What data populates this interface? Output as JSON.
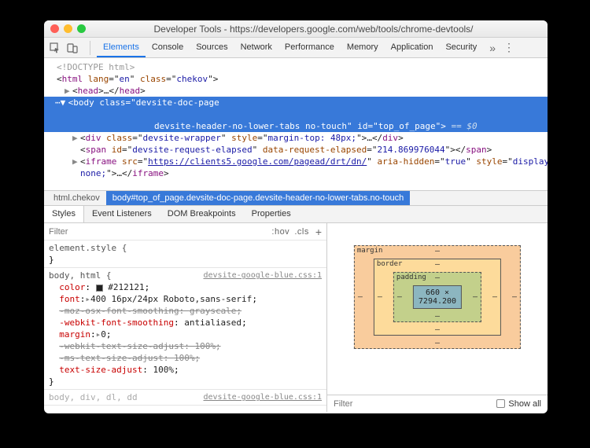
{
  "window": {
    "title": "Developer Tools - https://developers.google.com/web/tools/chrome-devtools/"
  },
  "toolbar": {
    "tabs": [
      "Elements",
      "Console",
      "Sources",
      "Network",
      "Performance",
      "Memory",
      "Application",
      "Security"
    ],
    "active": 0
  },
  "dom": {
    "doctype": "<!DOCTYPE html>",
    "html_open": {
      "tag": "html",
      "attrs": [
        [
          "lang",
          "en"
        ],
        [
          "class",
          "chekov"
        ]
      ]
    },
    "head": {
      "tag": "head",
      "ellipsis": "…"
    },
    "body_sel": {
      "tag": "body",
      "class_val": "devsite-doc-page",
      "class_tail": "devsite-header-no-lower-tabs no-touch",
      "id": "top_of_page",
      "eq0": "== $0"
    },
    "wrapper": {
      "tag": "div",
      "attrs": [
        [
          "class",
          "devsite-wrapper"
        ],
        [
          "style",
          "margin-top: 48px;"
        ]
      ],
      "ellipsis": "…"
    },
    "span": {
      "tag": "span",
      "attrs": [
        [
          "id",
          "devsite-request-elapsed"
        ],
        [
          "data-request-elapsed",
          "214.869976044"
        ]
      ]
    },
    "iframe": {
      "tag": "iframe",
      "src": "https://clients5.google.com/pagead/drt/dn/",
      "aria": "true",
      "style": "display:",
      "style2": "none;",
      "ellipsis": "…"
    }
  },
  "crumbs": [
    "html.chekov",
    "body#top_of_page.devsite-doc-page.devsite-header-no-lower-tabs.no-touch"
  ],
  "subtabs": [
    "Styles",
    "Event Listeners",
    "DOM Breakpoints",
    "Properties"
  ],
  "styles": {
    "filter_placeholder": "Filter",
    "hov": ":hov",
    "cls": ".cls",
    "element_style": "element.style {",
    "rule2_src": "devsite-google-blue.css:1",
    "rule2_sel": "body, html {",
    "rule2_props": [
      {
        "prop": "color",
        "val": "#212121",
        "swatch": true
      },
      {
        "prop": "font",
        "val": "400 16px/24px Roboto,sans-serif",
        "expand": true
      },
      {
        "prop": "-moz-osx-font-smoothing",
        "val": "grayscale",
        "strike": true
      },
      {
        "prop": "-webkit-font-smoothing",
        "val": "antialiased"
      },
      {
        "prop": "margin",
        "val": "0",
        "expand": true
      },
      {
        "prop": "-webkit-text-size-adjust",
        "val": "100%",
        "strike": true
      },
      {
        "prop": "-ms-text-size-adjust",
        "val": "100%",
        "strike": true
      },
      {
        "prop": "text-size-adjust",
        "val": "100%"
      }
    ],
    "rule3_sel": "body, div, dl, dd",
    "rule3_src": "devsite-google-blue.css:1"
  },
  "boxmodel": {
    "margin_label": "margin",
    "border_label": "border",
    "padding_label": "padding",
    "content": "660 × 7294.200",
    "dash": "–"
  },
  "computed": {
    "filter_placeholder": "Filter",
    "showall": "Show all"
  }
}
